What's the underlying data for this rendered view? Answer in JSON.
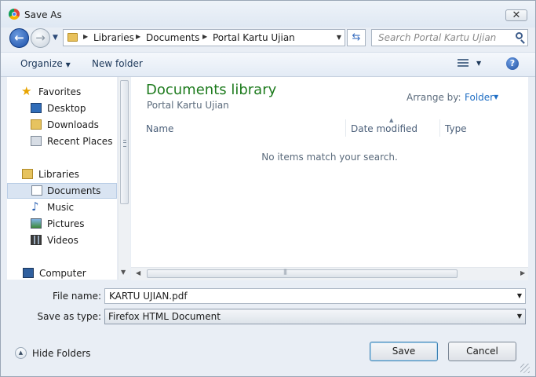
{
  "window": {
    "title": "Save As",
    "close_glyph": "✕"
  },
  "navigation": {
    "back_glyph": "←",
    "forward_glyph": "→",
    "breadcrumb": [
      "Libraries",
      "Documents",
      "Portal Kartu Ujian"
    ],
    "refresh_glyph": "⇆",
    "search_placeholder": "Search Portal Kartu Ujian"
  },
  "toolbar": {
    "organize_label": "Organize",
    "new_folder_label": "New folder",
    "help_glyph": "?"
  },
  "sidebar": {
    "favorites": {
      "label": "Favorites",
      "items": [
        "Desktop",
        "Downloads",
        "Recent Places"
      ]
    },
    "libraries": {
      "label": "Libraries",
      "items": [
        "Documents",
        "Music",
        "Pictures",
        "Videos"
      ],
      "selected": "Documents"
    },
    "computer": {
      "label": "Computer"
    }
  },
  "content": {
    "library_title": "Documents library",
    "library_subtitle": "Portal Kartu Ujian",
    "arrange_label": "Arrange by:",
    "arrange_value": "Folder",
    "columns": [
      "Name",
      "Date modified",
      "Type"
    ],
    "empty_message": "No items match your search."
  },
  "form": {
    "file_name_label": "File name:",
    "file_name_value": "KARTU UJIAN.pdf",
    "save_type_label": "Save as type:",
    "save_type_value": "Firefox HTML Document"
  },
  "footer": {
    "hide_folders_label": "Hide Folders",
    "save_label": "Save",
    "cancel_label": "Cancel"
  },
  "colors": {
    "library_title": "#1e7b1e",
    "link_blue": "#1f6ec4",
    "selection": "#d9e4f2"
  }
}
